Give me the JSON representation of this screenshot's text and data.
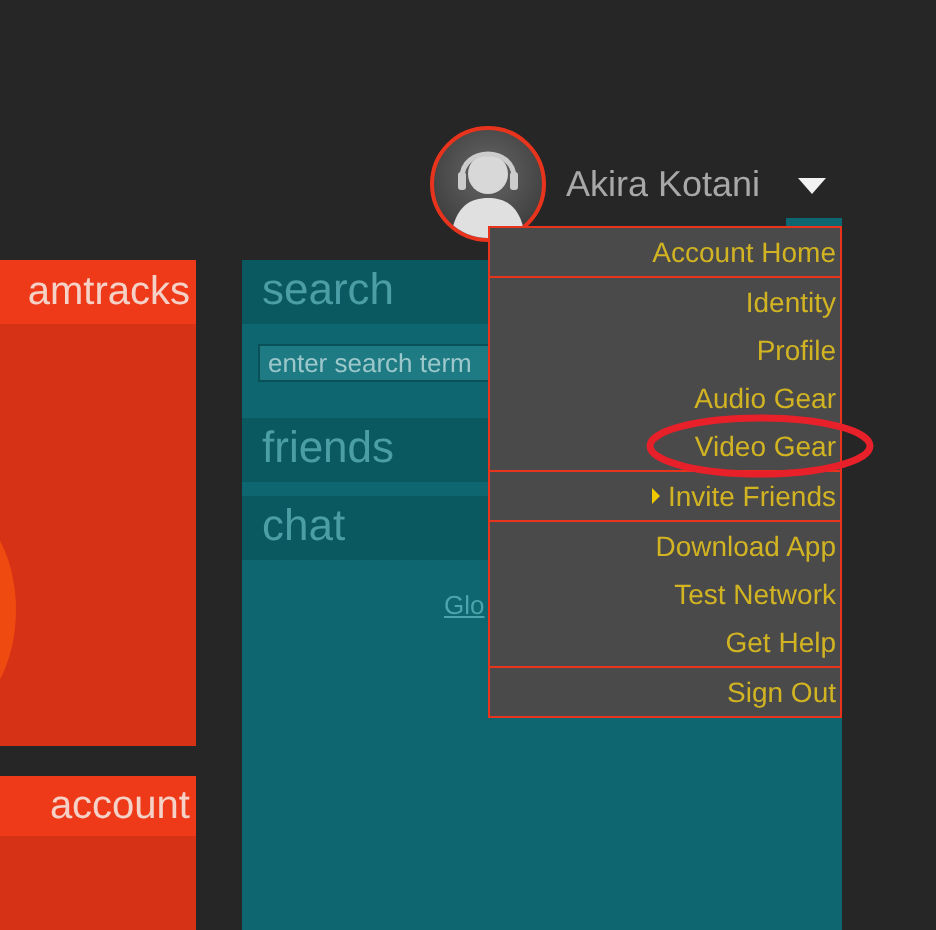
{
  "user": {
    "name": "Akira Kotani"
  },
  "left_panels": [
    {
      "title": "amtracks"
    },
    {
      "title": "account"
    }
  ],
  "side_panel": {
    "sections": [
      {
        "title": "search",
        "kind": "search",
        "placeholder": "enter search term"
      },
      {
        "title": "friends",
        "kind": "header"
      },
      {
        "title": "chat",
        "kind": "header"
      }
    ],
    "link": "Glo"
  },
  "menu": {
    "groups": [
      [
        {
          "label": "Account Home",
          "kind": "item"
        }
      ],
      [
        {
          "label": "Identity",
          "kind": "item"
        },
        {
          "label": "Profile",
          "kind": "item"
        },
        {
          "label": "Audio Gear",
          "kind": "item"
        },
        {
          "label": "Video Gear",
          "kind": "item"
        }
      ],
      [
        {
          "label": "Invite Friends",
          "kind": "submenu"
        }
      ],
      [
        {
          "label": "Download App",
          "kind": "item"
        },
        {
          "label": "Test Network",
          "kind": "item"
        },
        {
          "label": "Get Help",
          "kind": "item"
        }
      ],
      [
        {
          "label": "Sign Out",
          "kind": "item"
        }
      ]
    ]
  }
}
